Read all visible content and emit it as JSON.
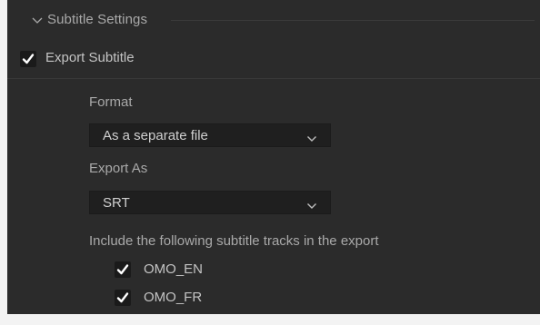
{
  "section": {
    "title": "Subtitle Settings",
    "collapse_icon": "chevron-down-icon"
  },
  "export_subtitle": {
    "label": "Export Subtitle",
    "checked": true,
    "check_icon": "checkmark-icon"
  },
  "format": {
    "label": "Format",
    "selected": "As a separate file",
    "dropdown_icon": "chevron-down-icon"
  },
  "export_as": {
    "label": "Export As",
    "selected": "SRT",
    "dropdown_icon": "chevron-down-icon"
  },
  "tracks": {
    "heading": "Include the following subtitle tracks in the export",
    "items": [
      {
        "label": "OMO_EN",
        "checked": true
      },
      {
        "label": "OMO_FR",
        "checked": true
      }
    ]
  },
  "colors": {
    "panel_background": "#2b2b2b",
    "dropdown_background": "#1f1f1f",
    "checkbox_background": "#1a1a1a",
    "check_mark": "#ffffff",
    "text": "#c4c4c4"
  }
}
